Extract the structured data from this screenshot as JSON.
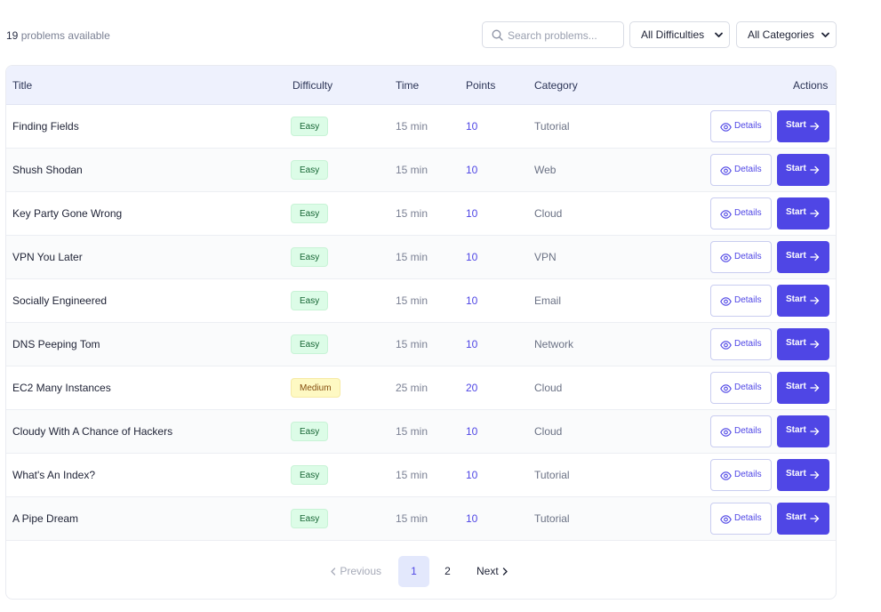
{
  "toolbar": {
    "count_number": "19",
    "count_suffix": "problems available",
    "search_placeholder": "Search problems...",
    "difficulty_select": "All Difficulties",
    "category_select": "All Categories"
  },
  "table": {
    "headers": {
      "title": "Title",
      "difficulty": "Difficulty",
      "time": "Time",
      "points": "Points",
      "category": "Category",
      "actions": "Actions"
    },
    "details_label": "Details",
    "start_label": "Start",
    "rows": [
      {
        "title": "Finding Fields",
        "difficulty": "Easy",
        "time": "15 min",
        "points": "10",
        "category": "Tutorial"
      },
      {
        "title": "Shush Shodan",
        "difficulty": "Easy",
        "time": "15 min",
        "points": "10",
        "category": "Web"
      },
      {
        "title": "Key Party Gone Wrong",
        "difficulty": "Easy",
        "time": "15 min",
        "points": "10",
        "category": "Cloud"
      },
      {
        "title": "VPN You Later",
        "difficulty": "Easy",
        "time": "15 min",
        "points": "10",
        "category": "VPN"
      },
      {
        "title": "Socially Engineered",
        "difficulty": "Easy",
        "time": "15 min",
        "points": "10",
        "category": "Email"
      },
      {
        "title": "DNS Peeping Tom",
        "difficulty": "Easy",
        "time": "15 min",
        "points": "10",
        "category": "Network"
      },
      {
        "title": "EC2 Many Instances",
        "difficulty": "Medium",
        "time": "25 min",
        "points": "20",
        "category": "Cloud"
      },
      {
        "title": "Cloudy With A Chance of Hackers",
        "difficulty": "Easy",
        "time": "15 min",
        "points": "10",
        "category": "Cloud"
      },
      {
        "title": "What's An Index?",
        "difficulty": "Easy",
        "time": "15 min",
        "points": "10",
        "category": "Tutorial"
      },
      {
        "title": "A Pipe Dream",
        "difficulty": "Easy",
        "time": "15 min",
        "points": "10",
        "category": "Tutorial"
      }
    ]
  },
  "pagination": {
    "previous": "Previous",
    "pages": [
      "1",
      "2"
    ],
    "next": "Next"
  },
  "colors": {
    "accent": "#4f46e5",
    "easy_bg": "#dcfce7",
    "medium_bg": "#fef9c3",
    "header_bg": "#eef1fd"
  }
}
